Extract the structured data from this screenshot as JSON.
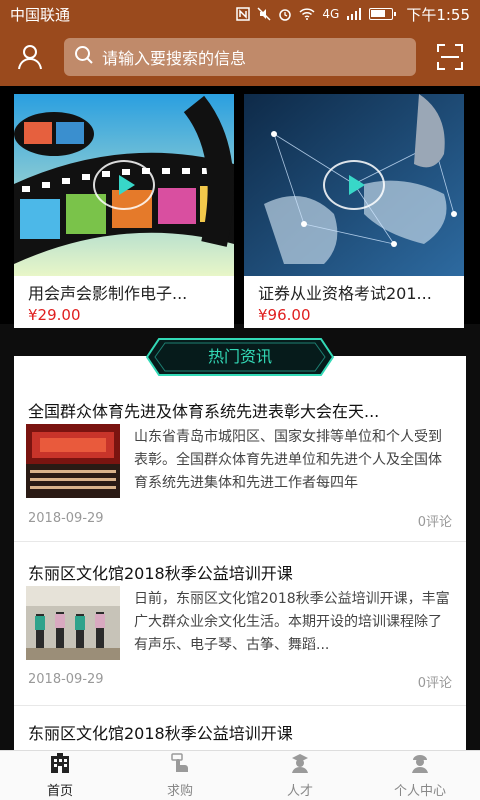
{
  "status": {
    "carrier": "中国联通",
    "signal": "4G",
    "time": "下午1:55"
  },
  "header": {
    "search_placeholder": "请输入要搜索的信息"
  },
  "products": [
    {
      "title": "用会声会影制作电子...",
      "price": "¥29.00"
    },
    {
      "title": "证券从业资格考试201...",
      "price": "¥96.00"
    }
  ],
  "news": {
    "section_title": "热门资讯",
    "items": [
      {
        "title": "全国群众体育先进及体育系统先进表彰大会在天...",
        "desc": "山东省青岛市城阳区、国家女排等单位和个人受到表彰。全国群众体育先进单位和先进个人及全国体育系统先进集体和先进工作者每四年",
        "date": "2018-09-29",
        "comments": "0评论"
      },
      {
        "title": "东丽区文化馆2018秋季公益培训开课",
        "desc": "日前，东丽区文化馆2018秋季公益培训开课，丰富广大群众业余文化生活。本期开设的培训课程除了有声乐、电子琴、古筝、舞蹈...",
        "date": "2018-09-29",
        "comments": "0评论"
      },
      {
        "title": "东丽区文化馆2018秋季公益培训开课"
      }
    ]
  },
  "tabs": [
    {
      "label": "首页",
      "icon": "home-icon",
      "active": true
    },
    {
      "label": "求购",
      "icon": "hand-icon"
    },
    {
      "label": "人才",
      "icon": "person-icon"
    },
    {
      "label": "个人中心",
      "icon": "profile-icon"
    }
  ],
  "colors": {
    "header": "#9a4a1d",
    "price": "#e02020",
    "accent": "#33d9b6"
  }
}
